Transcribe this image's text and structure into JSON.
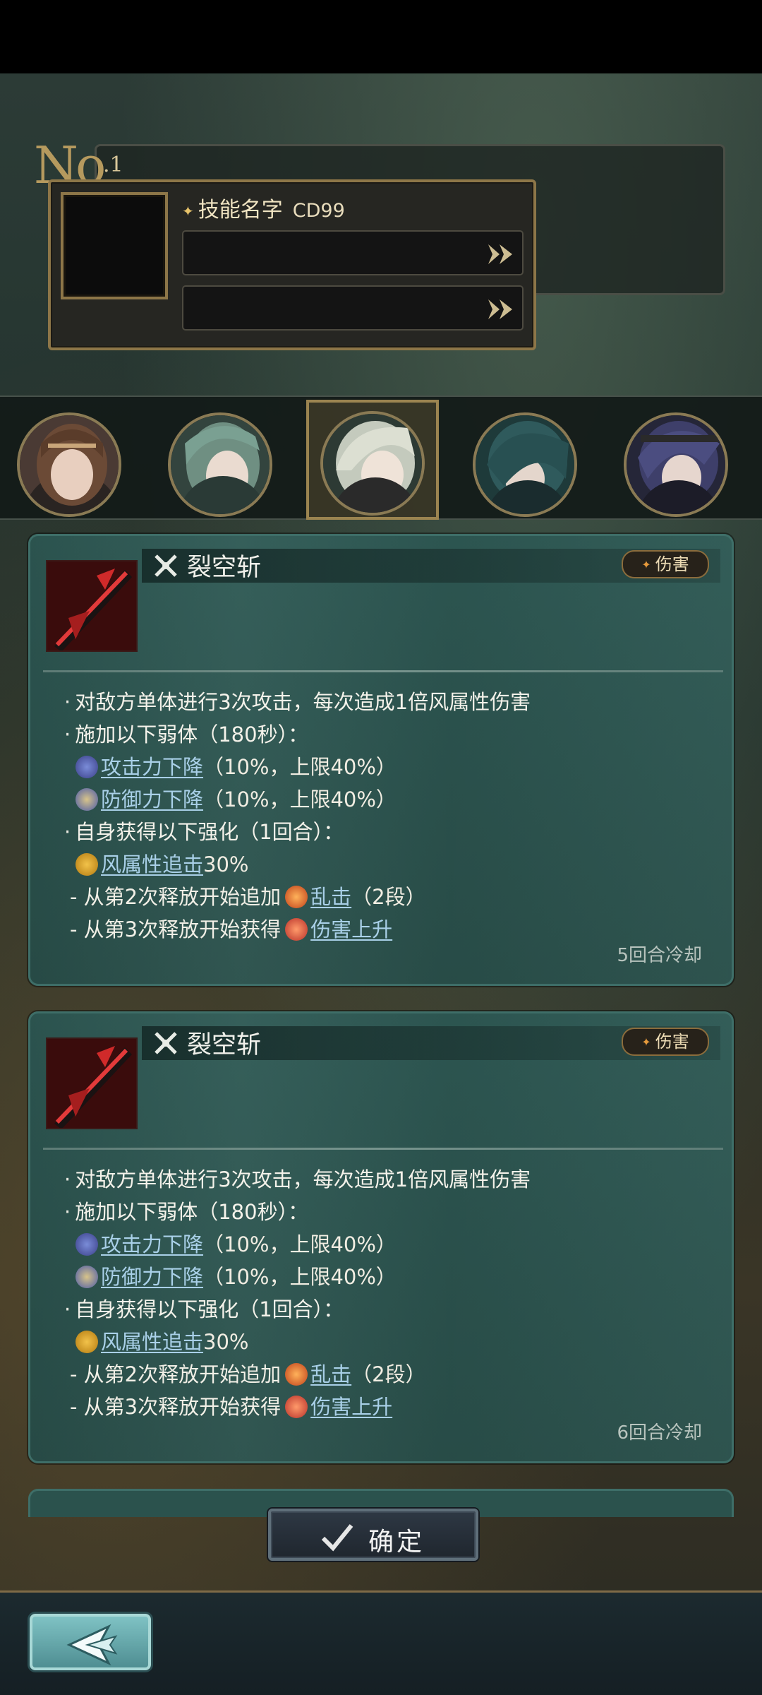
{
  "header": {
    "no_label": "No",
    "no_number": ".1",
    "skill_name": "技能名字",
    "skill_cd": "CD99"
  },
  "characters": [
    {
      "name": "character-1"
    },
    {
      "name": "character-2"
    },
    {
      "name": "character-3",
      "selected": true
    },
    {
      "name": "character-4"
    },
    {
      "name": "character-5"
    }
  ],
  "cards": [
    {
      "name": "裂空斩",
      "tag": "伤害",
      "line1": "对敌方单体进行3次攻击，每次造成1倍风属性伤害",
      "line2": "施加以下弱体（180秒）：",
      "debuff1_link": "攻击力下降",
      "debuff1_text": "（10%，上限40%）",
      "debuff2_link": "防御力下降",
      "debuff2_text": "（10%，上限40%）",
      "line3": "自身获得以下强化（1回合）：",
      "buff1_link": "风属性追击",
      "buff1_text": "30%",
      "sub1_text": "- 从第2次释放开始追加",
      "sub1_link": "乱击",
      "sub1_suffix": "（2段）",
      "sub2_text": "- 从第3次释放开始获得",
      "sub2_link": "伤害上升",
      "cooldown": "5回合冷却"
    },
    {
      "name": "裂空斩",
      "tag": "伤害",
      "line1": "对敌方单体进行3次攻击，每次造成1倍风属性伤害",
      "line2": "施加以下弱体（180秒）：",
      "debuff1_link": "攻击力下降",
      "debuff1_text": "（10%，上限40%）",
      "debuff2_link": "防御力下降",
      "debuff2_text": "（10%，上限40%）",
      "line3": "自身获得以下强化（1回合）：",
      "buff1_link": "风属性追击",
      "buff1_text": "30%",
      "sub1_text": "- 从第2次释放开始追加",
      "sub1_link": "乱击",
      "sub1_suffix": "（2段）",
      "sub2_text": "- 从第3次释放开始获得",
      "sub2_link": "伤害上升",
      "cooldown": "6回合冷却"
    }
  ],
  "footer": {
    "confirm_label": "确定"
  }
}
